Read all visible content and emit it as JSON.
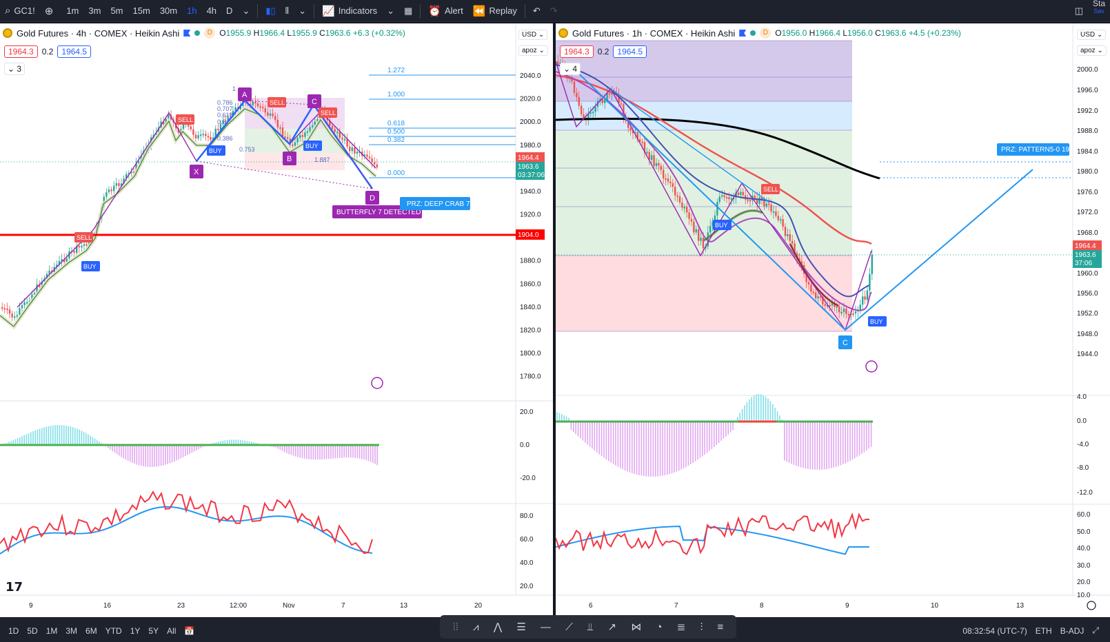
{
  "toolbar": {
    "symbol": "GC1!",
    "intervals": [
      "1m",
      "3m",
      "5m",
      "15m",
      "30m",
      "1h",
      "4h",
      "D"
    ],
    "active_interval": "1h",
    "indicators_label": "Indicators",
    "alert_label": "Alert",
    "replay_label": "Replay",
    "right_label": "Sta",
    "right_sub": "Sav"
  },
  "left_chart": {
    "title": "Gold Futures · 4h · COMEX · Heikin Ashi",
    "badge": "D",
    "ohlc": {
      "O": "1955.9",
      "H": "1966.4",
      "L": "1955.9",
      "C": "1963.6",
      "change": "+6.3 (+0.32%)"
    },
    "sell_price": "1964.3",
    "spread": "0.2",
    "buy_price": "1964.5",
    "collapse_count": "3",
    "currency": "USD",
    "scale_mode": "apoz",
    "price_labels": [
      "2040.0",
      "2020.0",
      "2000.0",
      "1980.0",
      "1960.0",
      "1940.0",
      "1920.0",
      "1900.0",
      "1880.0",
      "1860.0",
      "1840.0",
      "1820.0",
      "1800.0",
      "1780.0"
    ],
    "red_line_price": "1904.0",
    "last_price": "1964.4",
    "close_price": "1963.6",
    "countdown": "03:37:06",
    "fib_levels": [
      "1.272",
      "1.000",
      "0.618",
      "0.500",
      "0.382",
      "0.000"
    ],
    "pattern_points": [
      "X",
      "A",
      "B",
      "C",
      "D"
    ],
    "pattern_ratios": [
      "0.786",
      "0.707",
      "0.618",
      "0.5",
      "0.386",
      "0.753",
      "1.887",
      "1"
    ],
    "signals": [
      "SELL",
      "SELL",
      "SELL",
      "SELL",
      "BUY",
      "BUY",
      "BUY"
    ],
    "butterfly_label": "BUTTERFLY 7 DETECTED",
    "prz_label": "PRZ: DEEP CRAB 7",
    "osc_labels": [
      "20.0",
      "0.0",
      "-20.0"
    ],
    "rsi_labels": [
      "80.0",
      "60.0",
      "40.0",
      "20.0"
    ],
    "time_labels": [
      "9",
      "16",
      "23",
      "12:00",
      "Nov",
      "7",
      "13",
      "20"
    ],
    "tv_logo": "17"
  },
  "right_chart": {
    "title": "Gold Futures · 1h · COMEX · Heikin Ashi",
    "badge": "D",
    "ohlc": {
      "O": "1956.0",
      "H": "1966.4",
      "L": "1956.0",
      "C": "1963.6",
      "change": "+4.5 (+0.23%)"
    },
    "sell_price": "1964.3",
    "spread": "0.2",
    "buy_price": "1964.5",
    "collapse_count": "4",
    "currency": "USD",
    "scale_mode": "apoz",
    "price_labels": [
      "2000.0",
      "1996.0",
      "1992.0",
      "1988.0",
      "1984.0",
      "1980.0",
      "1976.0",
      "1972.0",
      "1968.0",
      "1964.0",
      "1960.0",
      "1956.0",
      "1952.0",
      "1948.0",
      "1944.0"
    ],
    "last_price": "1964.4",
    "close_price": "1963.6",
    "countdown": "37:06",
    "signals": [
      "SELL",
      "BUY",
      "BUY"
    ],
    "point_label": "C",
    "prz_label": "PRZ: PATTERN5-0 19",
    "osc_labels": [
      "4.0",
      "0.0",
      "-4.0",
      "-8.0",
      "-12.0"
    ],
    "rsi_labels": [
      "60.0",
      "50.0",
      "40.0",
      "30.0",
      "20.0",
      "10.0"
    ],
    "time_labels": [
      "6",
      "7",
      "8",
      "9",
      "10",
      "13"
    ]
  },
  "bottombar": {
    "ranges": [
      "1D",
      "5D",
      "1M",
      "3M",
      "6M",
      "YTD",
      "1Y",
      "5Y",
      "All"
    ],
    "time": "08:32:54 (UTC-7)",
    "session": "ETH",
    "adjust": "B-ADJ"
  },
  "colors": {
    "up": "#26a69a",
    "down": "#ef5350",
    "pattern": "#9c27b0",
    "blue": "#2962ff",
    "red_line": "#f00",
    "prz": "#2196f3"
  }
}
